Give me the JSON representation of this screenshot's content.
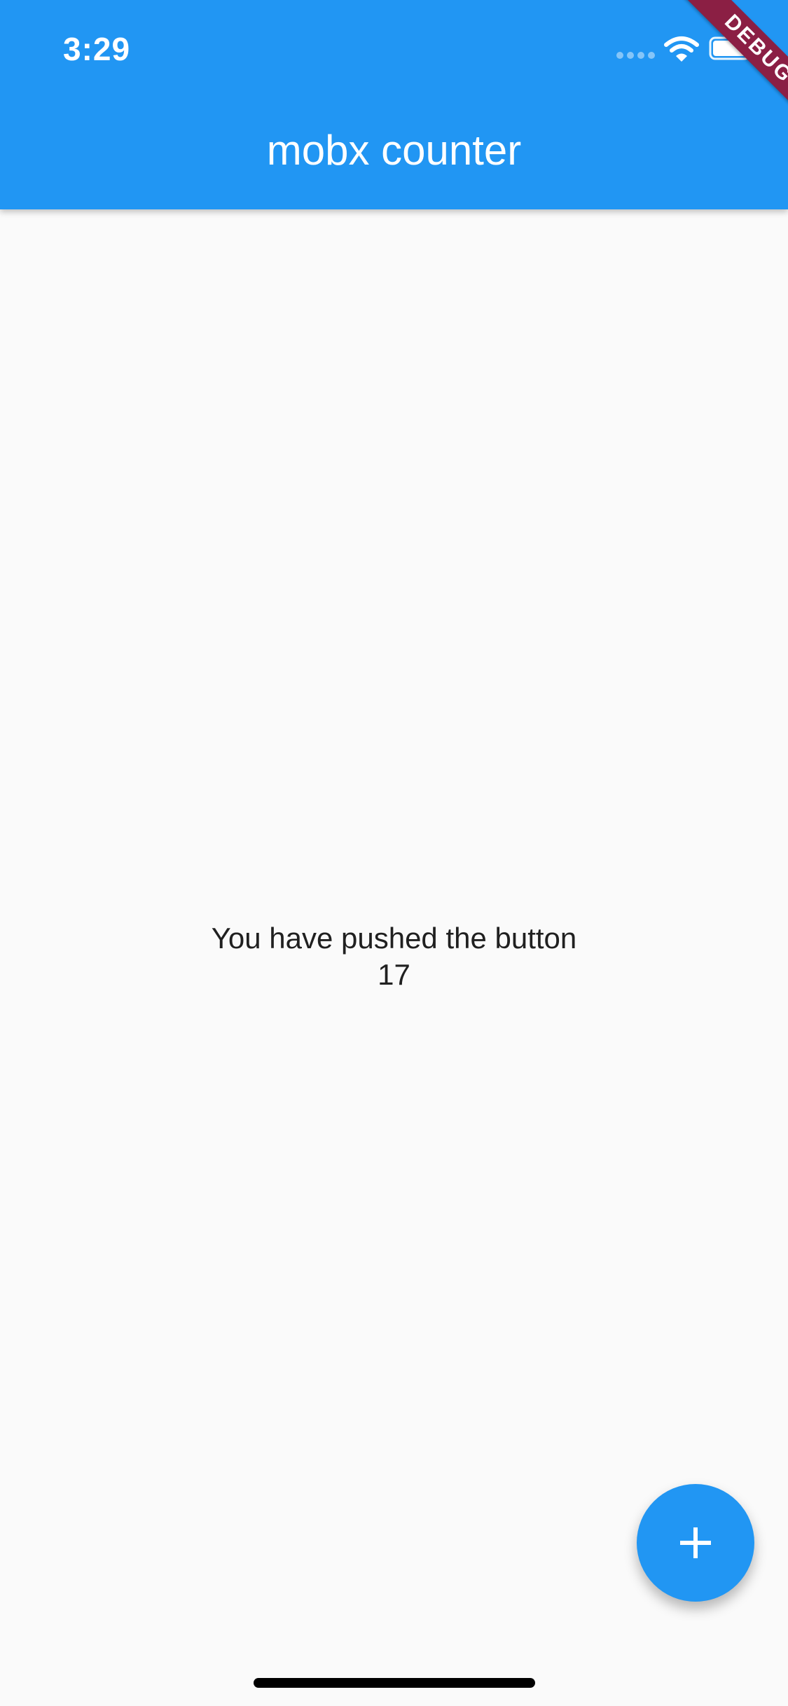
{
  "status_bar": {
    "time": "3:29"
  },
  "app_bar": {
    "title": "mobx counter",
    "color": "#2196f3"
  },
  "debug_banner": {
    "label": "DEBUG",
    "color": "#8b1f44"
  },
  "counter": {
    "label": "You have pushed the button",
    "value": "17"
  },
  "fab": {
    "icon": "plus-icon",
    "color": "#2196f3"
  }
}
